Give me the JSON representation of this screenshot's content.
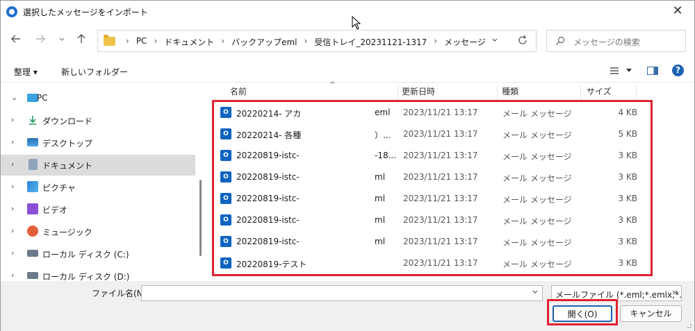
{
  "window": {
    "title": "選択したメッセージをインポート"
  },
  "nav": {
    "back_icon": "arrow-left-icon",
    "forward_icon": "arrow-right-icon",
    "recent_icon": "chevron-down-icon",
    "up_icon": "arrow-up-icon"
  },
  "address": {
    "crumbs": [
      "PC",
      "ドキュメント",
      "バックアップeml",
      "受信トレイ_20231121-1317",
      "メッセージ"
    ]
  },
  "search": {
    "placeholder": "メッセージの検索"
  },
  "toolbar": {
    "organize_label": "整理 ▾",
    "new_folder_label": "新しいフォルダー"
  },
  "sidebar": {
    "items": [
      {
        "label": "PC",
        "icon": "monitor-icon",
        "expanded": true
      },
      {
        "label": "ダウンロード",
        "icon": "download-icon"
      },
      {
        "label": "デスクトップ",
        "icon": "desktop-icon"
      },
      {
        "label": "ドキュメント",
        "icon": "document-icon",
        "selected": true
      },
      {
        "label": "ピクチャ",
        "icon": "picture-icon"
      },
      {
        "label": "ビデオ",
        "icon": "video-icon"
      },
      {
        "label": "ミュージック",
        "icon": "music-icon"
      },
      {
        "label": "ローカル ディスク (C:)",
        "icon": "drive-icon"
      },
      {
        "label": "ローカル ディスク (D:)",
        "icon": "drive-icon"
      }
    ]
  },
  "columns": {
    "name": "名前",
    "modified": "更新日時",
    "type": "種類",
    "size": "サイズ"
  },
  "files": [
    {
      "name": "20220214- アカ",
      "tail": "eml",
      "date": "2023/11/21 13:17",
      "type": "メール メッセージ",
      "size": "4 KB"
    },
    {
      "name": "20220214- 各種",
      "tail": "）...",
      "date": "2023/11/21 13:17",
      "type": "メール メッセージ",
      "size": "5 KB"
    },
    {
      "name": "20220819-istc-",
      "tail": "-18...",
      "date": "2023/11/21 13:17",
      "type": "メール メッセージ",
      "size": "3 KB"
    },
    {
      "name": "20220819-istc-",
      "tail": "ml",
      "date": "2023/11/21 13:17",
      "type": "メール メッセージ",
      "size": "3 KB"
    },
    {
      "name": "20220819-istc-",
      "tail": "ml",
      "date": "2023/11/21 13:17",
      "type": "メール メッセージ",
      "size": "3 KB"
    },
    {
      "name": "20220819-istc-",
      "tail": "ml",
      "date": "2023/11/21 13:17",
      "type": "メール メッセージ",
      "size": "3 KB"
    },
    {
      "name": "20220819-istc-",
      "tail": "ml",
      "date": "2023/11/21 13:17",
      "type": "メール メッセージ",
      "size": "3 KB"
    },
    {
      "name": "20220819-テスト",
      "tail": "",
      "date": "2023/11/21 13:17",
      "type": "メール メッセージ",
      "size": "3 KB"
    }
  ],
  "bottom": {
    "filename_label": "ファイル名(N):",
    "filename_value": "",
    "filter_value": "メールファイル (*.eml;*.emlx;*.nws)",
    "open_label": "開く(O)",
    "cancel_label": "キャンセル"
  },
  "colors": {
    "highlight": "#e02030",
    "accent": "#1d62b4",
    "outlook": "#0f64c0"
  }
}
